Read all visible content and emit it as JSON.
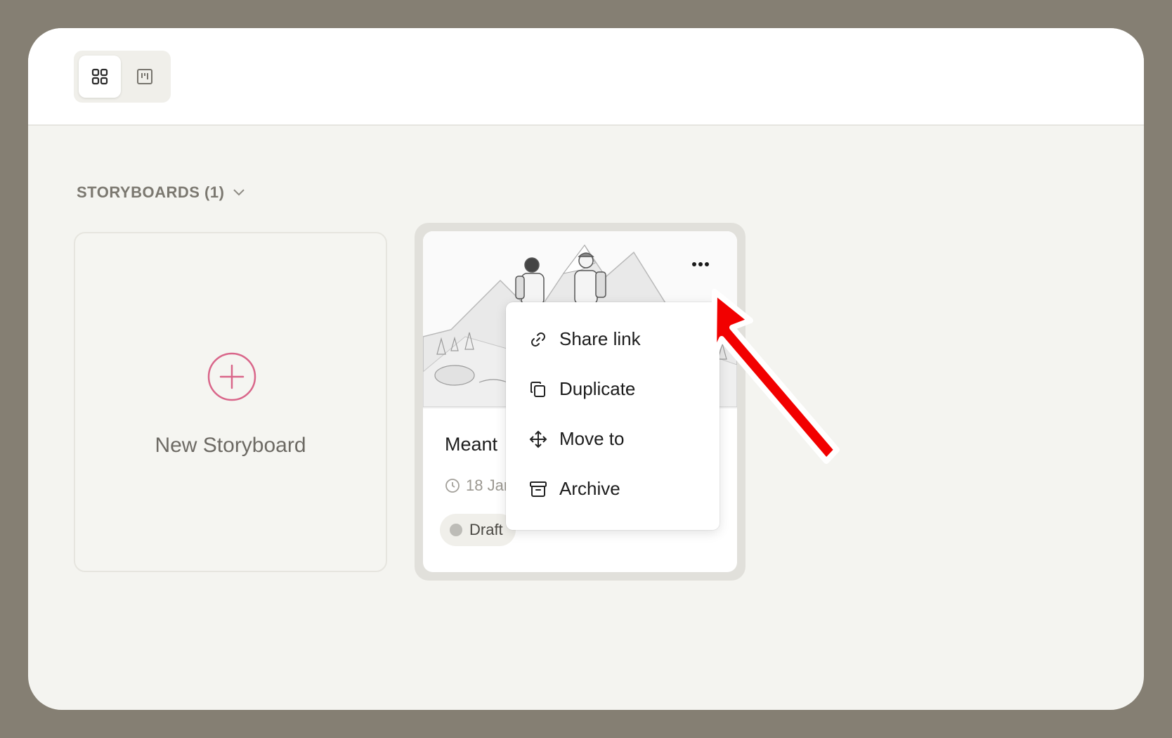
{
  "toolbar": {
    "view_toggle": [
      {
        "name": "grid-view",
        "icon": "grid-icon",
        "active": true
      },
      {
        "name": "board-view",
        "icon": "board-icon",
        "active": false
      }
    ]
  },
  "section": {
    "title": "STORYBOARDS (1)",
    "icon": "chevron-down-icon"
  },
  "new_card": {
    "label": "New Storyboard",
    "icon": "plus-circle-icon",
    "accent_color": "#d9668a"
  },
  "storyboard": {
    "title": "Meant ",
    "date": "18 Jar",
    "status": "Draft",
    "more_icon": "ellipsis-icon",
    "thumbnail": "hikers-mountain-sketch"
  },
  "context_menu": {
    "items": [
      {
        "label": "Share link",
        "icon": "link-icon"
      },
      {
        "label": "Duplicate",
        "icon": "copy-icon"
      },
      {
        "label": "Move to",
        "icon": "move-icon"
      },
      {
        "label": "Archive",
        "icon": "archive-icon"
      }
    ]
  },
  "annotation": {
    "type": "arrow",
    "color": "#f20000"
  }
}
